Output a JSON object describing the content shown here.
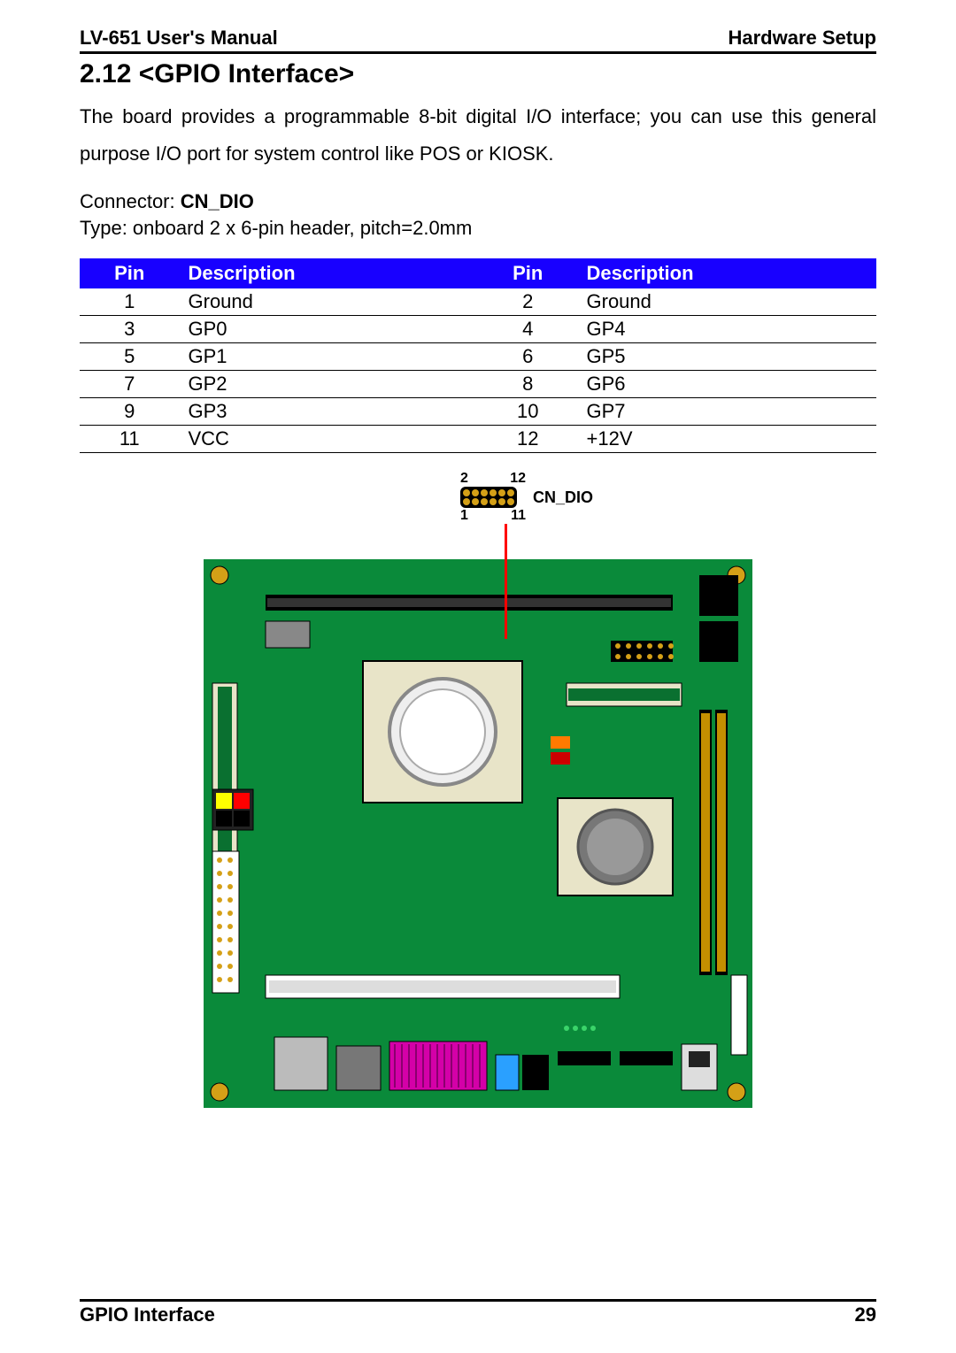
{
  "header": {
    "left": "LV-651 User's Manual",
    "right": "Hardware Setup"
  },
  "section": {
    "title": "2.12 <GPIO Interface>",
    "paragraph": "The board provides a programmable 8-bit digital I/O interface; you can use this general purpose I/O port for system control like POS or KIOSK."
  },
  "connector": {
    "label": "Connector: ",
    "name": "CN_DIO",
    "type": "Type: onboard 2 x 6-pin header, pitch=2.0mm"
  },
  "table": {
    "headers": {
      "pin": "Pin",
      "desc": "Description"
    },
    "rows": [
      {
        "p1": "1",
        "d1": "Ground",
        "p2": "2",
        "d2": "Ground"
      },
      {
        "p1": "3",
        "d1": "GP0",
        "p2": "4",
        "d2": "GP4"
      },
      {
        "p1": "5",
        "d1": "GP1",
        "p2": "6",
        "d2": "GP5"
      },
      {
        "p1": "7",
        "d1": "GP2",
        "p2": "8",
        "d2": "GP6"
      },
      {
        "p1": "9",
        "d1": "GP3",
        "p2": "10",
        "d2": "GP7"
      },
      {
        "p1": "11",
        "d1": "VCC",
        "p2": "12",
        "d2": "+12V"
      }
    ]
  },
  "diagram": {
    "pin2": "2",
    "pin12": "12",
    "pin1": "1",
    "pin11": "11",
    "cn_dio": "CN_DIO"
  },
  "footer": {
    "left": "GPIO Interface",
    "right": "29"
  }
}
